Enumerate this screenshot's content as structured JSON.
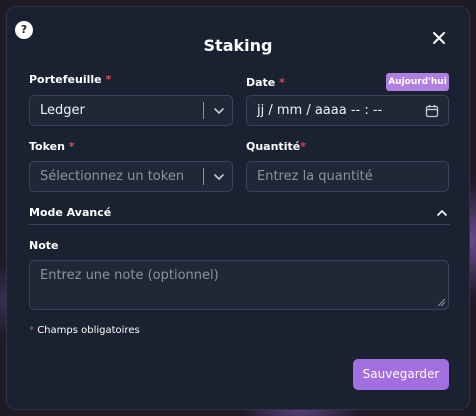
{
  "modal": {
    "title": "Staking",
    "help_glyph": "?",
    "close_glyph": "✕"
  },
  "wallet": {
    "label": "Portefeuille",
    "required_mark": "*",
    "value": "Ledger"
  },
  "date": {
    "label": "Date",
    "required_mark": "*",
    "today_button": "Aujourd'hui",
    "value": "jj / mm / aaaa   -- : --"
  },
  "token": {
    "label": "Token",
    "required_mark": "*",
    "placeholder": "Sélectionnez un token"
  },
  "quantity": {
    "label": "Quantité",
    "required_mark": "*",
    "placeholder": "Entrez la quantité"
  },
  "advanced": {
    "label": "Mode Avancé",
    "expanded": true
  },
  "note": {
    "label": "Note",
    "placeholder": "Entrez une note (optionnel)"
  },
  "footer": {
    "required_mark": "*",
    "required_text": "Champs obligatoires",
    "save_label": "Sauvegarder"
  },
  "colors": {
    "accent": "#a36ee0",
    "badge": "#b07fe0",
    "required": "#e5484d",
    "panel": "#1a2130"
  }
}
